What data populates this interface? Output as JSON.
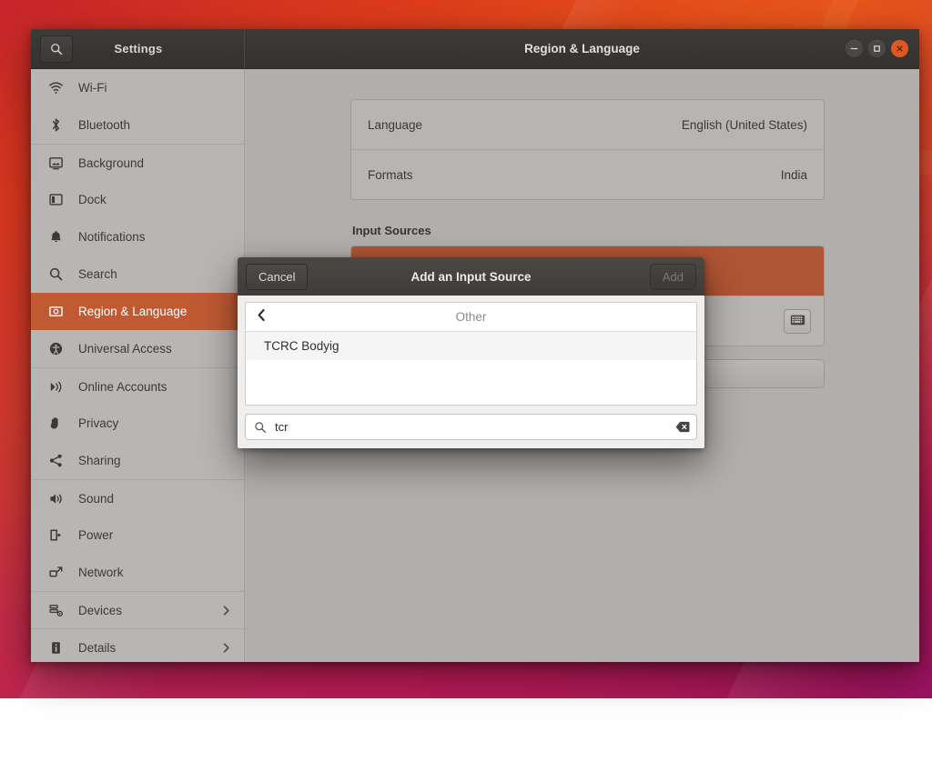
{
  "window": {
    "app_title": "Settings",
    "page_title": "Region & Language",
    "search_icon": "search-icon",
    "controls": {
      "minimize": "minimize-icon",
      "maximize": "maximize-icon",
      "close": "close-icon"
    }
  },
  "sidebar": {
    "items": [
      {
        "label": "Wi-Fi",
        "icon": "wifi-icon",
        "active": false,
        "chevron": false,
        "separator": false
      },
      {
        "label": "Bluetooth",
        "icon": "bluetooth-icon",
        "active": false,
        "chevron": false,
        "separator": false
      },
      {
        "label": "Background",
        "icon": "background-icon",
        "active": false,
        "chevron": false,
        "separator": true
      },
      {
        "label": "Dock",
        "icon": "dock-icon",
        "active": false,
        "chevron": false,
        "separator": false
      },
      {
        "label": "Notifications",
        "icon": "bell-icon",
        "active": false,
        "chevron": false,
        "separator": false
      },
      {
        "label": "Search",
        "icon": "search-icon",
        "active": false,
        "chevron": false,
        "separator": false
      },
      {
        "label": "Region & Language",
        "icon": "region-language-icon",
        "active": true,
        "chevron": false,
        "separator": false
      },
      {
        "label": "Universal Access",
        "icon": "accessibility-icon",
        "active": false,
        "chevron": false,
        "separator": false
      },
      {
        "label": "Online Accounts",
        "icon": "online-accounts-icon",
        "active": false,
        "chevron": false,
        "separator": true
      },
      {
        "label": "Privacy",
        "icon": "hand-icon",
        "active": false,
        "chevron": false,
        "separator": false
      },
      {
        "label": "Sharing",
        "icon": "share-icon",
        "active": false,
        "chevron": false,
        "separator": false
      },
      {
        "label": "Sound",
        "icon": "speaker-icon",
        "active": false,
        "chevron": false,
        "separator": true
      },
      {
        "label": "Power",
        "icon": "power-icon",
        "active": false,
        "chevron": false,
        "separator": false
      },
      {
        "label": "Network",
        "icon": "network-icon",
        "active": false,
        "chevron": false,
        "separator": false
      },
      {
        "label": "Devices",
        "icon": "devices-icon",
        "active": false,
        "chevron": true,
        "separator": true
      },
      {
        "label": "Details",
        "icon": "info-icon",
        "active": false,
        "chevron": true,
        "separator": true
      }
    ]
  },
  "main": {
    "language_row": {
      "label": "Language",
      "value": "English (United States)"
    },
    "formats_row": {
      "label": "Formats",
      "value": "India"
    },
    "input_sources": {
      "title": "Input Sources",
      "rows": [
        {
          "label": "",
          "selected": true,
          "keyboard_icon": false
        },
        {
          "label": "",
          "selected": false,
          "keyboard_icon": true
        }
      ]
    }
  },
  "dialog": {
    "title": "Add an Input Source",
    "cancel_label": "Cancel",
    "add_label": "Add",
    "add_disabled": true,
    "list_header": "Other",
    "back_icon": "chevron-left-icon",
    "items": [
      {
        "label": "TCRC Bodyig"
      }
    ],
    "search": {
      "value": "tcr",
      "placeholder": "Search",
      "icon": "search-icon",
      "clear_icon": "clear-icon"
    }
  },
  "colors": {
    "accent_orange": "#b05535",
    "sidebar_selected": "#bf5a33",
    "titlebar": "#3d3b37",
    "close_button": "#e2561f",
    "sidebar_bg": "#b8b6b4",
    "content_bg": "#b1afad"
  }
}
